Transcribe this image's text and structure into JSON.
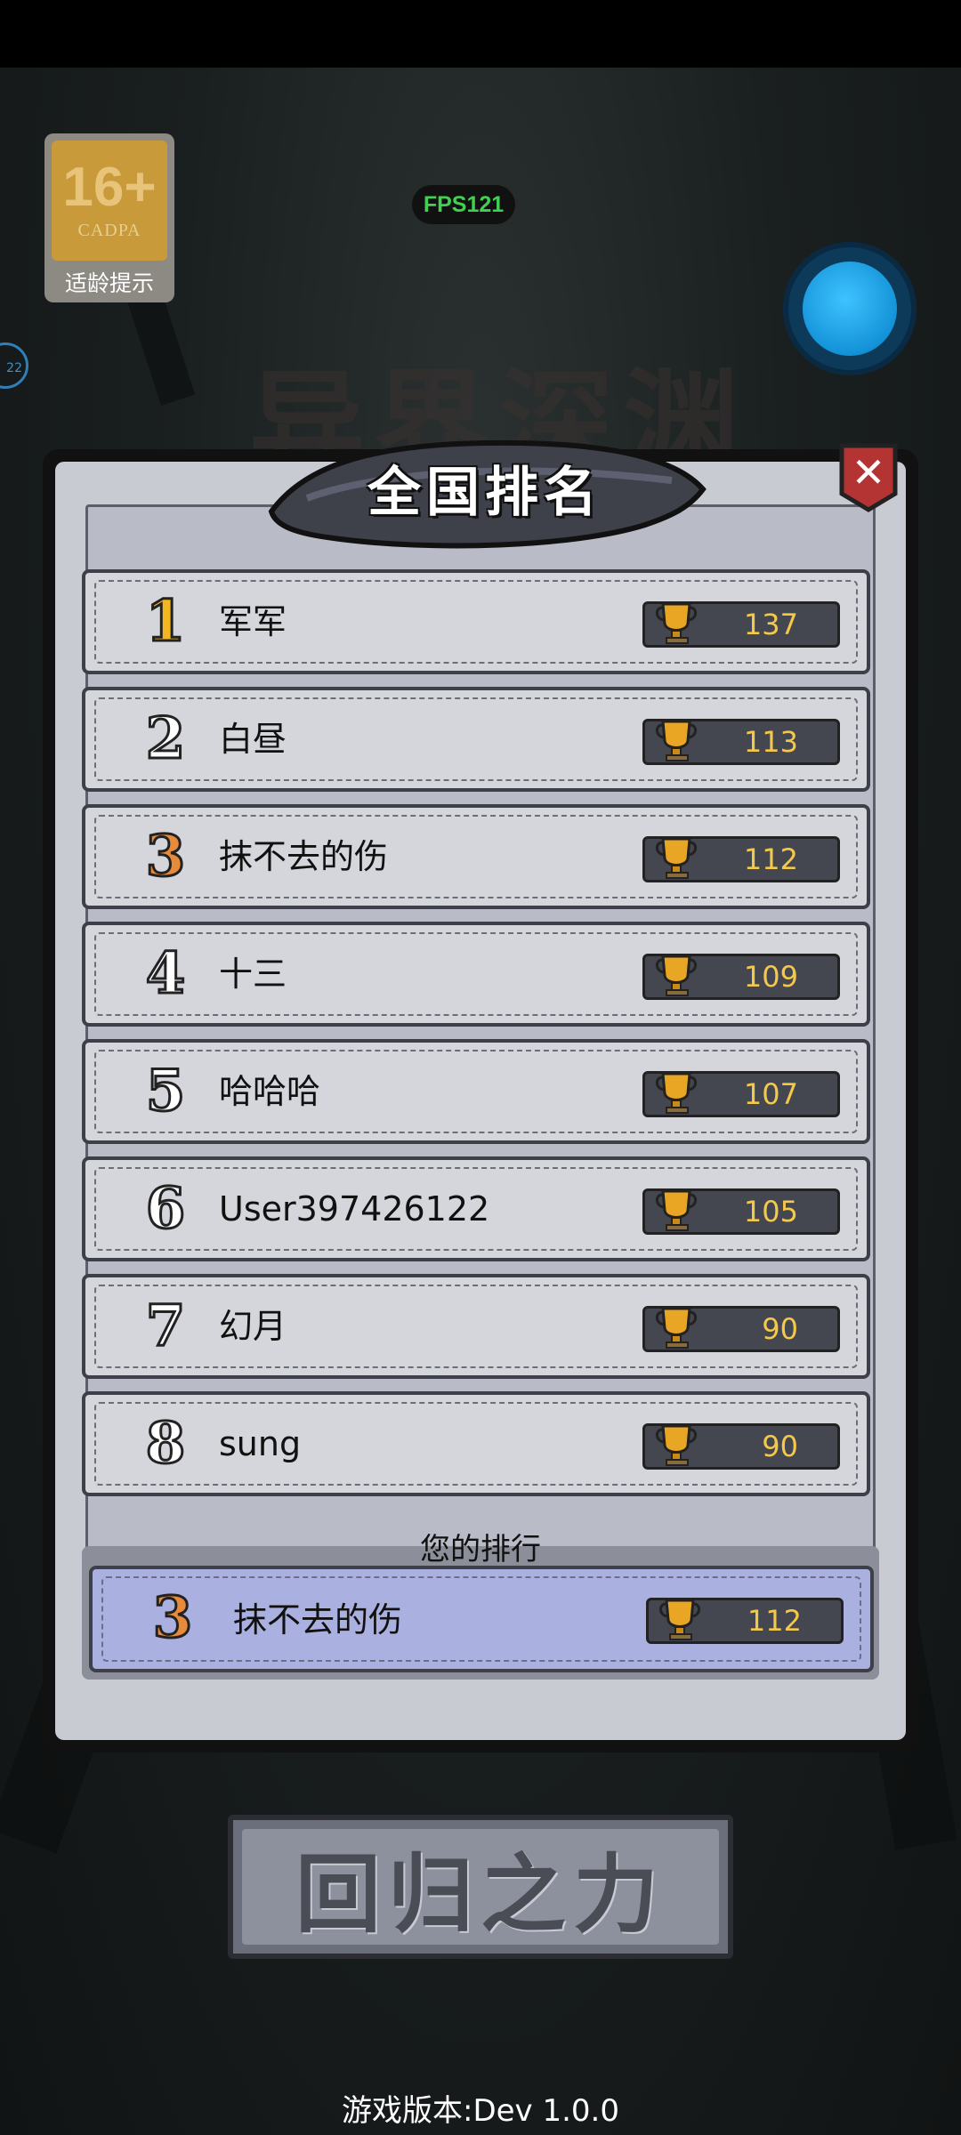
{
  "status": {
    "fps": "FPS121"
  },
  "age_badge": {
    "age": "16+",
    "org": "CADPA",
    "tip": "适龄提示"
  },
  "side_indicator": "22",
  "background_title": "异界深渊",
  "dialog": {
    "title": "全国排名",
    "close_icon": "close-x-icon",
    "rankings": [
      {
        "rank": "1",
        "name": "军军",
        "score": "137",
        "rank_style": "gold"
      },
      {
        "rank": "2",
        "name": "白昼",
        "score": "113",
        "rank_style": "silver"
      },
      {
        "rank": "3",
        "name": "抹不去的伤",
        "score": "112",
        "rank_style": "bronze"
      },
      {
        "rank": "4",
        "name": "十三",
        "score": "109",
        "rank_style": "plain"
      },
      {
        "rank": "5",
        "name": "哈哈哈",
        "score": "107",
        "rank_style": "plain"
      },
      {
        "rank": "6",
        "name": "User397426122",
        "score": "105",
        "rank_style": "plain"
      },
      {
        "rank": "7",
        "name": "幻月",
        "score": "90",
        "rank_style": "plain"
      },
      {
        "rank": "8",
        "name": "sung",
        "score": "90",
        "rank_style": "plain"
      }
    ],
    "your_rank_label": "您的排行",
    "your_rank": {
      "rank": "3",
      "name": "抹不去的伤",
      "score": "112"
    }
  },
  "return_button": {
    "label": "回归之力"
  },
  "footer": {
    "version": "游戏版本:Dev 1.0.0"
  },
  "colors": {
    "gold": "#f2b623",
    "bronze": "#e78a3a",
    "score_text": "#f4c94a",
    "highlight_row": "#aab1e0",
    "fps_green": "#3fd14f"
  }
}
